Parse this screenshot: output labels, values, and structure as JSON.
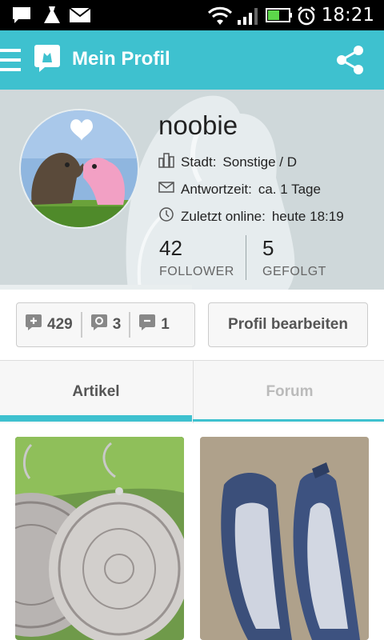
{
  "status_bar": {
    "time": "18:21",
    "icons": [
      "chat-notification-icon",
      "dress-icon",
      "mail-icon",
      "wifi-icon",
      "signal-icon",
      "battery-icon",
      "alarm-icon"
    ]
  },
  "app_bar": {
    "title": "Mein Profil",
    "icons": [
      "menu-icon",
      "app-logo-icon",
      "share-icon"
    ]
  },
  "profile": {
    "username": "noobie",
    "city_label": "Stadt:",
    "city_value": "Sonstige / D",
    "response_label": "Antwortzeit:",
    "response_value": "ca. 1 Tage",
    "last_online_label": "Zuletzt online:",
    "last_online_value": "heute 18:19",
    "followers_count": "42",
    "followers_label": "FOLLOWER",
    "following_count": "5",
    "following_label": "GEFOLGT"
  },
  "ratings": {
    "positive": "429",
    "neutral": "3",
    "negative": "1"
  },
  "edit_button_label": "Profil bearbeiten",
  "tabs": [
    {
      "label": "Artikel",
      "active": true
    },
    {
      "label": "Forum",
      "active": false
    }
  ],
  "colors": {
    "accent": "#3ec1cf",
    "header_bg": "#cfd8da",
    "text_dark": "#222222",
    "text_muted": "#666666"
  }
}
